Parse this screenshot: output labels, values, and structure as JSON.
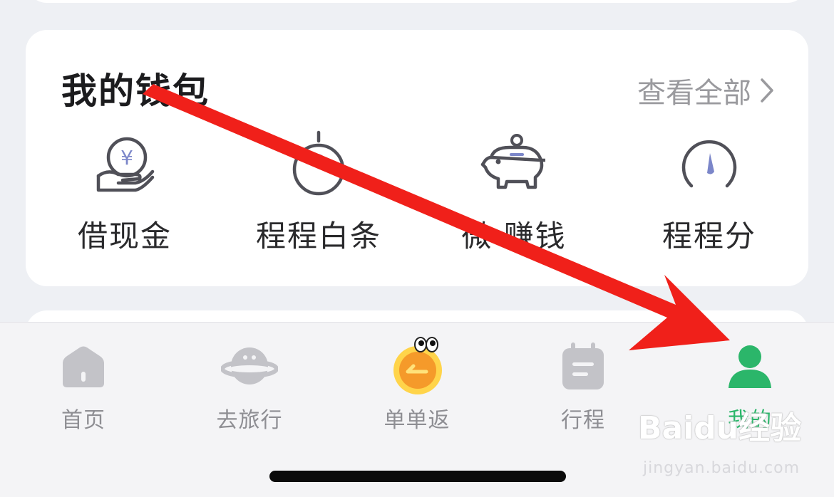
{
  "wallet": {
    "title": "我的钱包",
    "view_all": "查看全部",
    "items": [
      {
        "label": "借现金",
        "icon": "yuan-hand-icon"
      },
      {
        "label": "程程白条",
        "icon": "timer-icon"
      },
      {
        "label": "微·赚钱",
        "icon": "piggy-bank-icon"
      },
      {
        "label": "程程分",
        "icon": "speedometer-icon"
      }
    ]
  },
  "tabbar": {
    "items": [
      {
        "label": "首页",
        "icon": "home-icon",
        "active": false
      },
      {
        "label": "去旅行",
        "icon": "planet-icon",
        "active": false
      },
      {
        "label": "单单返",
        "icon": "cashback-coin-icon",
        "active": false
      },
      {
        "label": "行程",
        "icon": "calendar-icon",
        "active": false
      },
      {
        "label": "我的",
        "icon": "person-icon",
        "active": true
      }
    ]
  },
  "colors": {
    "accent_green": "#2bb66a",
    "arrow_red": "#f0201a",
    "inactive_gray": "#8e8e93"
  },
  "watermark": {
    "brand": "Baidu经验",
    "url": "jingyan.baidu.com"
  }
}
